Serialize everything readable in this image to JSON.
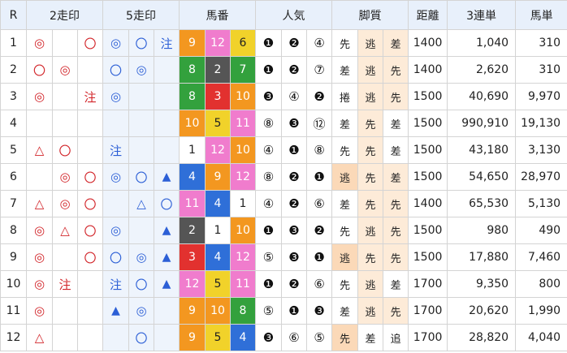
{
  "headers": [
    "R",
    "2走印",
    "5走印",
    "馬番",
    "人気",
    "脚質",
    "距離",
    "3連単",
    "馬単"
  ],
  "colors": {
    "header_bg": "#e8f0fb",
    "highlight_bg": "#eef4fc",
    "mark_red": "#d2252a",
    "mark_blue": "#2c5fd6",
    "post": {
      "1": "#ffffff",
      "2": "#555555",
      "3": "#e2312f",
      "4": "#2f6fd8",
      "5": "#f1d22a",
      "6": "#33a13d",
      "7": "#f39720",
      "8": "#f07ccd"
    },
    "leg_dark": "#fbd9b8",
    "leg_light": "#fdebd8"
  },
  "rows": [
    {
      "r": "1",
      "m2": [
        "◎",
        "",
        "〇"
      ],
      "m5": [
        "◎",
        "〇",
        "注"
      ],
      "horses": [
        {
          "n": "9",
          "c": "7"
        },
        {
          "n": "12",
          "c": "8"
        },
        {
          "n": "6",
          "c": "5"
        }
      ],
      "pop": [
        "❶",
        "❷",
        "④"
      ],
      "leg": [
        {
          "t": "先",
          "s": "w"
        },
        {
          "t": "逃",
          "s": "l"
        },
        {
          "t": "差",
          "s": "l"
        }
      ],
      "dist": "1400",
      "tri": "1,040",
      "ex": "310"
    },
    {
      "r": "2",
      "m2": [
        "〇",
        "◎",
        ""
      ],
      "m5": [
        "〇",
        "◎",
        ""
      ],
      "horses": [
        {
          "n": "8",
          "c": "6"
        },
        {
          "n": "2",
          "c": "2"
        },
        {
          "n": "7",
          "c": "6"
        }
      ],
      "pop": [
        "❶",
        "❷",
        "⑦"
      ],
      "leg": [
        {
          "t": "差",
          "s": "w"
        },
        {
          "t": "逃",
          "s": "l"
        },
        {
          "t": "先",
          "s": "l"
        }
      ],
      "dist": "1400",
      "tri": "2,620",
      "ex": "310"
    },
    {
      "r": "3",
      "m2": [
        "◎",
        "",
        "注"
      ],
      "m5": [
        "◎",
        "",
        ""
      ],
      "horses": [
        {
          "n": "8",
          "c": "6"
        },
        {
          "n": "3",
          "c": "3"
        },
        {
          "n": "10",
          "c": "7"
        }
      ],
      "pop": [
        "❸",
        "④",
        "❷"
      ],
      "leg": [
        {
          "t": "捲",
          "s": "w"
        },
        {
          "t": "逃",
          "s": "l"
        },
        {
          "t": "先",
          "s": "l"
        }
      ],
      "dist": "1500",
      "tri": "40,690",
      "ex": "9,970"
    },
    {
      "r": "4",
      "m2": [
        "",
        "",
        ""
      ],
      "m5": [
        "",
        "",
        ""
      ],
      "horses": [
        {
          "n": "10",
          "c": "7"
        },
        {
          "n": "5",
          "c": "5"
        },
        {
          "n": "11",
          "c": "8"
        }
      ],
      "pop": [
        "⑧",
        "❸",
        "⑫"
      ],
      "leg": [
        {
          "t": "差",
          "s": "w"
        },
        {
          "t": "先",
          "s": "l"
        },
        {
          "t": "差",
          "s": "w"
        }
      ],
      "dist": "1500",
      "tri": "990,910",
      "ex": "19,130"
    },
    {
      "r": "5",
      "m2": [
        "△",
        "〇",
        ""
      ],
      "m5": [
        "注",
        "",
        ""
      ],
      "horses": [
        {
          "n": "1",
          "c": "1"
        },
        {
          "n": "12",
          "c": "8"
        },
        {
          "n": "10",
          "c": "7"
        }
      ],
      "pop": [
        "④",
        "❶",
        "⑧"
      ],
      "leg": [
        {
          "t": "先",
          "s": "w"
        },
        {
          "t": "先",
          "s": "l"
        },
        {
          "t": "差",
          "s": "w"
        }
      ],
      "dist": "1500",
      "tri": "43,180",
      "ex": "3,130"
    },
    {
      "r": "6",
      "m2": [
        "",
        "◎",
        "〇"
      ],
      "m5": [
        "◎",
        "〇",
        "▲"
      ],
      "horses": [
        {
          "n": "4",
          "c": "4"
        },
        {
          "n": "9",
          "c": "7"
        },
        {
          "n": "12",
          "c": "8"
        }
      ],
      "pop": [
        "⑧",
        "❷",
        "❶"
      ],
      "leg": [
        {
          "t": "逃",
          "s": "o"
        },
        {
          "t": "先",
          "s": "l"
        },
        {
          "t": "差",
          "s": "l"
        }
      ],
      "dist": "1500",
      "tri": "54,650",
      "ex": "28,970"
    },
    {
      "r": "7",
      "m2": [
        "△",
        "◎",
        "〇"
      ],
      "m5": [
        "",
        "△",
        "〇"
      ],
      "horses": [
        {
          "n": "11",
          "c": "8"
        },
        {
          "n": "4",
          "c": "4"
        },
        {
          "n": "1",
          "c": "1"
        }
      ],
      "pop": [
        "④",
        "❷",
        "⑥"
      ],
      "leg": [
        {
          "t": "差",
          "s": "w"
        },
        {
          "t": "先",
          "s": "l"
        },
        {
          "t": "先",
          "s": "l"
        }
      ],
      "dist": "1400",
      "tri": "65,530",
      "ex": "5,130"
    },
    {
      "r": "8",
      "m2": [
        "◎",
        "△",
        "〇"
      ],
      "m5": [
        "◎",
        "",
        "▲"
      ],
      "horses": [
        {
          "n": "2",
          "c": "2"
        },
        {
          "n": "1",
          "c": "1"
        },
        {
          "n": "10",
          "c": "7"
        }
      ],
      "pop": [
        "❶",
        "❸",
        "❷"
      ],
      "leg": [
        {
          "t": "先",
          "s": "w"
        },
        {
          "t": "逃",
          "s": "l"
        },
        {
          "t": "先",
          "s": "l"
        }
      ],
      "dist": "1500",
      "tri": "980",
      "ex": "490"
    },
    {
      "r": "9",
      "m2": [
        "◎",
        "",
        "〇"
      ],
      "m5": [
        "〇",
        "◎",
        "▲"
      ],
      "horses": [
        {
          "n": "3",
          "c": "3"
        },
        {
          "n": "4",
          "c": "4"
        },
        {
          "n": "12",
          "c": "8"
        }
      ],
      "pop": [
        "⑤",
        "❸",
        "❶"
      ],
      "leg": [
        {
          "t": "逃",
          "s": "o"
        },
        {
          "t": "先",
          "s": "l"
        },
        {
          "t": "先",
          "s": "l"
        }
      ],
      "dist": "1500",
      "tri": "17,880",
      "ex": "7,460"
    },
    {
      "r": "10",
      "m2": [
        "◎",
        "注",
        ""
      ],
      "m5": [
        "注",
        "〇",
        "▲"
      ],
      "horses": [
        {
          "n": "12",
          "c": "8"
        },
        {
          "n": "5",
          "c": "5"
        },
        {
          "n": "11",
          "c": "8"
        }
      ],
      "pop": [
        "❶",
        "❷",
        "⑥"
      ],
      "leg": [
        {
          "t": "先",
          "s": "w"
        },
        {
          "t": "逃",
          "s": "l"
        },
        {
          "t": "差",
          "s": "w"
        }
      ],
      "dist": "1700",
      "tri": "9,350",
      "ex": "800"
    },
    {
      "r": "11",
      "m2": [
        "◎",
        "",
        ""
      ],
      "m5": [
        "▲",
        "◎",
        ""
      ],
      "horses": [
        {
          "n": "9",
          "c": "7"
        },
        {
          "n": "10",
          "c": "7"
        },
        {
          "n": "8",
          "c": "6"
        }
      ],
      "pop": [
        "⑤",
        "❶",
        "❸"
      ],
      "leg": [
        {
          "t": "差",
          "s": "w"
        },
        {
          "t": "逃",
          "s": "l"
        },
        {
          "t": "先",
          "s": "l"
        }
      ],
      "dist": "1700",
      "tri": "20,620",
      "ex": "1,990"
    },
    {
      "r": "12",
      "m2": [
        "△",
        "",
        ""
      ],
      "m5": [
        "",
        "〇",
        ""
      ],
      "horses": [
        {
          "n": "9",
          "c": "7"
        },
        {
          "n": "5",
          "c": "5"
        },
        {
          "n": "4",
          "c": "4"
        }
      ],
      "pop": [
        "❸",
        "⑥",
        "⑤"
      ],
      "leg": [
        {
          "t": "先",
          "s": "o"
        },
        {
          "t": "差",
          "s": "w"
        },
        {
          "t": "追",
          "s": "w"
        }
      ],
      "dist": "1700",
      "tri": "28,820",
      "ex": "4,040"
    }
  ]
}
